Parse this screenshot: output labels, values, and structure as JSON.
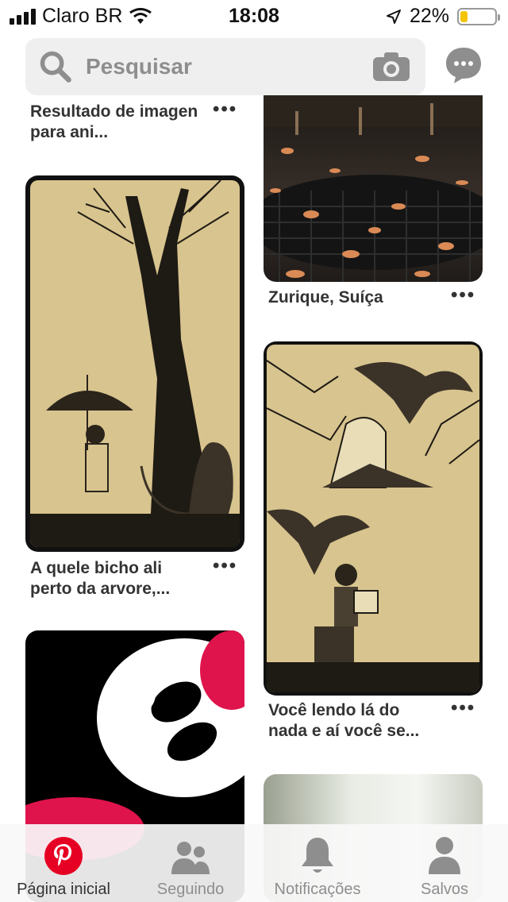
{
  "status_bar": {
    "carrier": "Claro BR",
    "time": "18:08",
    "battery_percent": "22%",
    "battery_level": 0.22
  },
  "search": {
    "placeholder": "Pesquisar"
  },
  "pins": [
    {
      "title": "Resultado de imagen para ani...",
      "more": "•••"
    },
    {
      "title": "Zurique, Suíça",
      "more": "•••"
    },
    {
      "title": "A quele bicho ali perto da arvore,...",
      "more": "•••"
    },
    {
      "title": "Você lendo lá do nada e aí você se...",
      "more": "•••"
    }
  ],
  "tabs": [
    {
      "label": "Página inicial",
      "icon": "pinterest-logo-icon",
      "active": true
    },
    {
      "label": "Seguindo",
      "icon": "people-icon",
      "active": false
    },
    {
      "label": "Notificações",
      "icon": "bell-icon",
      "active": false
    },
    {
      "label": "Salvos",
      "icon": "person-icon",
      "active": false
    }
  ],
  "colors": {
    "brand_red": "#e60023",
    "battery_yellow": "#f5c400",
    "inactive_icon": "#8e8e8e"
  }
}
